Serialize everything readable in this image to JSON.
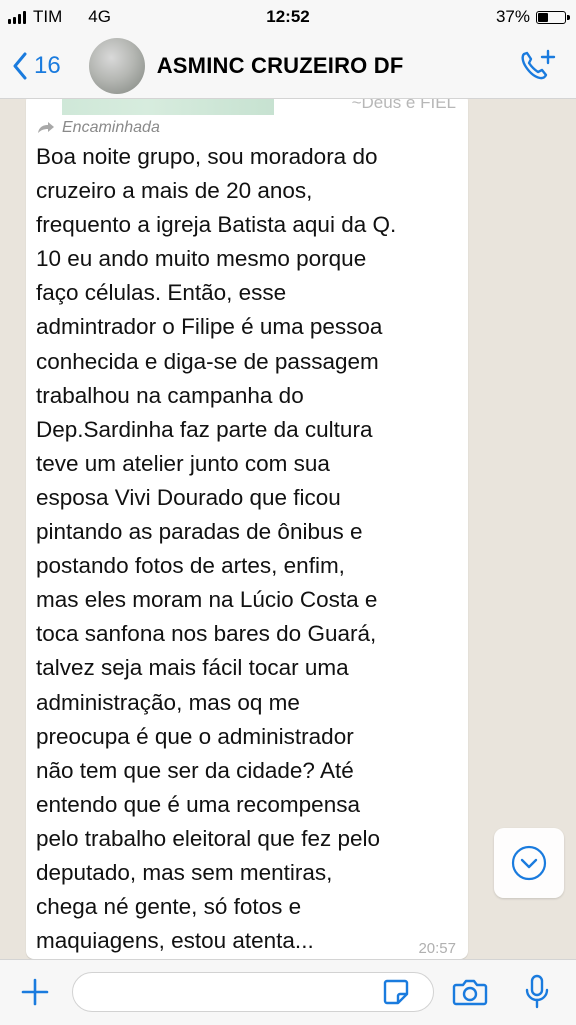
{
  "status_bar": {
    "carrier": "TIM",
    "network": "4G",
    "time": "12:52",
    "battery_percent": "37%",
    "battery_level": 0.37
  },
  "header": {
    "back_count": "16",
    "title": "ASMINC CRUZEIRO DF"
  },
  "message": {
    "sender": "~Deus e FIEL",
    "forwarded_label": "Encaminhada",
    "text": "Boa noite grupo, sou moradora do\ncruzeiro a mais de 20 anos,\nfrequento a igreja Batista aqui da Q.\n10 eu ando muito mesmo porque\nfaço células. Então, esse\nadmintrador o Filipe é uma pessoa\nconhecida e diga-se de passagem\ntrabalhou na campanha do\nDep.Sardinha faz parte da cultura\nteve um atelier junto com sua\nesposa Vivi Dourado que ficou\npintando as paradas de ônibus e\npostando fotos de artes, enfim,\nmas eles moram na Lúcio Costa e\ntoca sanfona nos bares do Guará,\ntalvez seja mais fácil tocar uma\nadministração, mas oq me\npreocupa é que o administrador\nnão tem que ser da cidade? Até\nentendo que é uma recompensa\npelo trabalho eleitoral que fez pelo\ndeputado, mas sem mentiras,\nchega né gente, só fotos e\nmaquiagens, estou atenta...",
    "time": "20:57"
  },
  "input": {
    "value": "",
    "placeholder": ""
  },
  "icons": {
    "back": "chevron-left-icon",
    "call": "phone-add-icon",
    "scroll": "chevron-down-circle-icon",
    "plus": "plus-icon",
    "sticker": "sticker-icon",
    "camera": "camera-icon",
    "mic": "microphone-icon"
  },
  "colors": {
    "accent": "#1a7bde",
    "chat_background": "#e9e4dc",
    "bubble": "#ffffff",
    "bar": "#f7f7f7"
  }
}
